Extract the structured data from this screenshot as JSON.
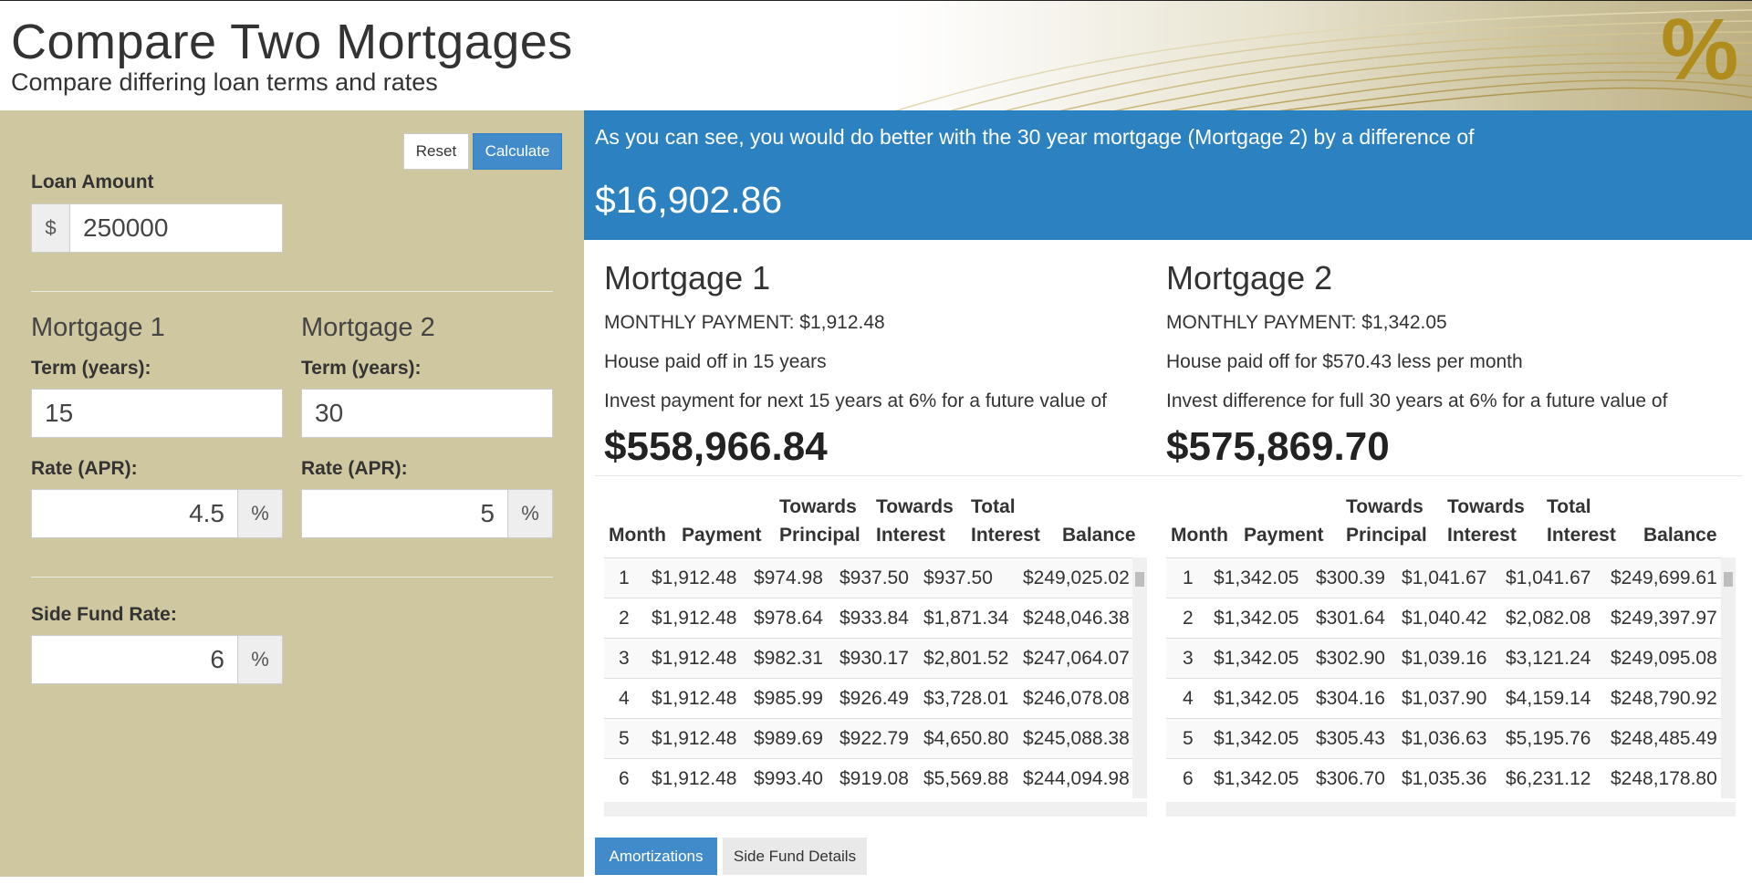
{
  "header": {
    "title": "Compare Two Mortgages",
    "subtitle": "Compare differing loan terms and rates",
    "logo_glyph": "%"
  },
  "form": {
    "reset_label": "Reset",
    "calculate_label": "Calculate",
    "loan_amount_label": "Loan Amount",
    "currency_symbol": "$",
    "loan_amount_value": "250000",
    "mortgage1_heading": "Mortgage 1",
    "mortgage2_heading": "Mortgage 2",
    "term_label": "Term (years):",
    "rate_label": "Rate (APR):",
    "term1_value": "15",
    "term2_value": "30",
    "rate1_value": "4.5",
    "rate2_value": "5",
    "percent_symbol": "%",
    "side_fund_label": "Side Fund Rate:",
    "side_fund_value": "6"
  },
  "result": {
    "message": "As you can see, you would do better with the 30 year mortgage (Mortgage 2) by a difference of",
    "difference": "$16,902.86"
  },
  "mortgage1": {
    "title": "Mortgage 1",
    "monthly_payment": "MONTHLY PAYMENT: $1,912.48",
    "note": "House paid off in 15 years",
    "invest_text": "Invest payment for next 15 years at 6% for a future value of",
    "future_value": "$558,966.84"
  },
  "mortgage2": {
    "title": "Mortgage 2",
    "monthly_payment": "MONTHLY PAYMENT: $1,342.05",
    "note": "House paid off for $570.43 less per month",
    "invest_text": "Invest difference for full 30 years at 6% for a future value of",
    "future_value": "$575,869.70"
  },
  "table_headers": {
    "month": "Month",
    "payment": "Payment",
    "towards": "Towards",
    "principal": "Principal",
    "interest": "Interest",
    "total": "Total",
    "balance": "Balance"
  },
  "amort1": [
    [
      "1",
      "$1,912.48",
      "$974.98",
      "$937.50",
      "$937.50",
      "$249,025.02"
    ],
    [
      "2",
      "$1,912.48",
      "$978.64",
      "$933.84",
      "$1,871.34",
      "$248,046.38"
    ],
    [
      "3",
      "$1,912.48",
      "$982.31",
      "$930.17",
      "$2,801.52",
      "$247,064.07"
    ],
    [
      "4",
      "$1,912.48",
      "$985.99",
      "$926.49",
      "$3,728.01",
      "$246,078.08"
    ],
    [
      "5",
      "$1,912.48",
      "$989.69",
      "$922.79",
      "$4,650.80",
      "$245,088.38"
    ],
    [
      "6",
      "$1,912.48",
      "$993.40",
      "$919.08",
      "$5,569.88",
      "$244,094.98"
    ]
  ],
  "amort2": [
    [
      "1",
      "$1,342.05",
      "$300.39",
      "$1,041.67",
      "$1,041.67",
      "$249,699.61"
    ],
    [
      "2",
      "$1,342.05",
      "$301.64",
      "$1,040.42",
      "$2,082.08",
      "$249,397.97"
    ],
    [
      "3",
      "$1,342.05",
      "$302.90",
      "$1,039.16",
      "$3,121.24",
      "$249,095.08"
    ],
    [
      "4",
      "$1,342.05",
      "$304.16",
      "$1,037.90",
      "$4,159.14",
      "$248,790.92"
    ],
    [
      "5",
      "$1,342.05",
      "$305.43",
      "$1,036.63",
      "$5,195.76",
      "$248,485.49"
    ],
    [
      "6",
      "$1,342.05",
      "$306.70",
      "$1,035.36",
      "$6,231.12",
      "$248,178.80"
    ]
  ],
  "tabs": {
    "amortizations": "Amortizations",
    "side_fund_details": "Side Fund Details"
  },
  "colors": {
    "left_panel": "#cfc79f",
    "banner": "#2c82c0",
    "primary_button": "#428bca",
    "logo": "#b08c1c"
  }
}
